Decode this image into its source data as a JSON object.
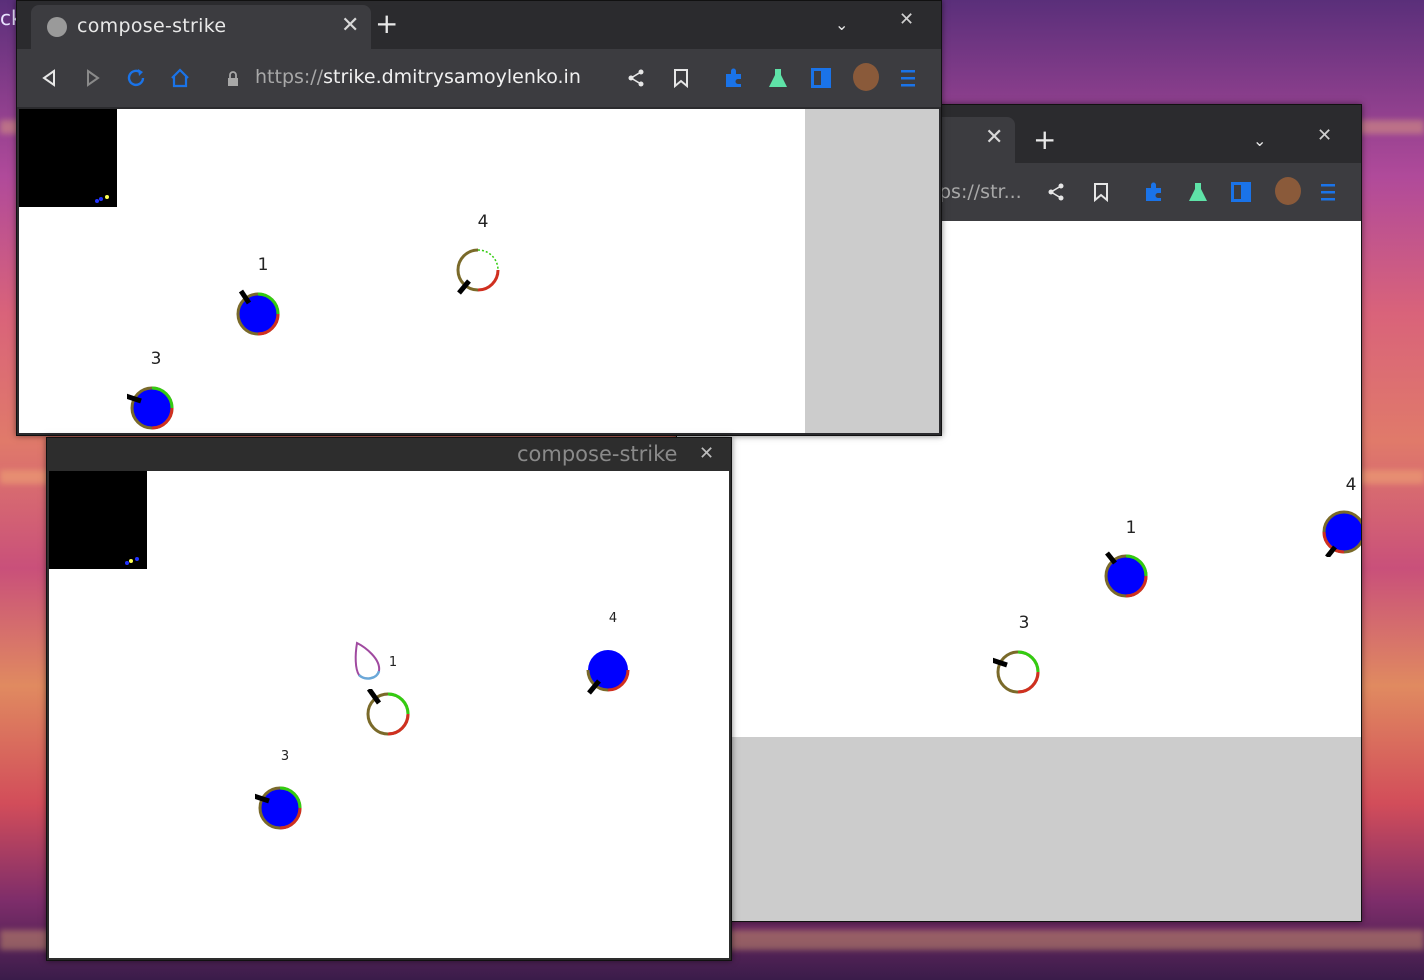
{
  "desktop": {
    "label": "ck"
  },
  "browser1": {
    "tab_title": "compose-strike",
    "url_scheme": "https://",
    "url_host": "strike.dmitrysamoylenko.in",
    "players": [
      {
        "label": "1"
      },
      {
        "label": "4"
      },
      {
        "label": "3"
      }
    ]
  },
  "browser2": {
    "url_fragment": "ps://str...",
    "players": [
      {
        "label": "1"
      },
      {
        "label": "3"
      },
      {
        "label": "4"
      }
    ]
  },
  "app_window": {
    "title": "compose-strike",
    "players": [
      {
        "label": "1"
      },
      {
        "label": "4"
      },
      {
        "label": "3"
      }
    ]
  },
  "colors": {
    "player_fill": "#0000ff",
    "health": "#33cc11",
    "damage": "#d03020",
    "outline": "#7a6a2a",
    "gun": "#000000"
  },
  "icons": {
    "back": "back-icon",
    "forward": "forward-icon",
    "reload": "reload-icon",
    "home": "home-icon",
    "lock": "lock-icon",
    "share": "share-icon",
    "bookmark": "bookmark-icon",
    "extensions": "puzzle-icon",
    "labs": "flask-icon",
    "sidepanel": "sidepanel-icon",
    "profile": "avatar",
    "menu": "menu-icon"
  }
}
